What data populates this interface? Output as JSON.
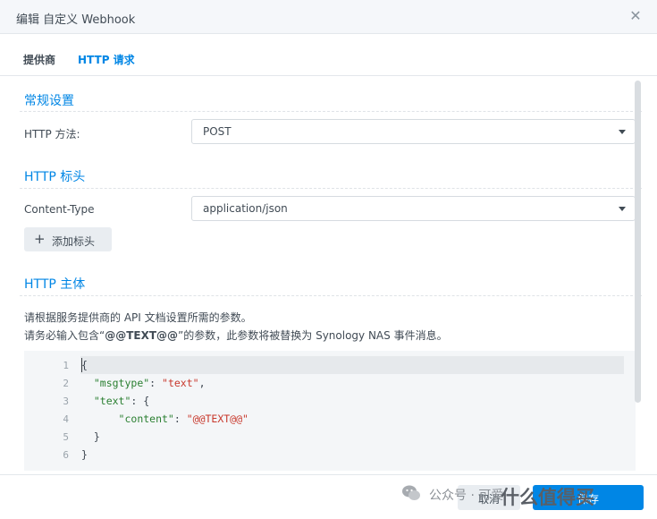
{
  "window": {
    "title": "编辑 自定义 Webhook",
    "close_icon": "close-icon"
  },
  "tabs": [
    {
      "label": "提供商"
    },
    {
      "label": "HTTP 请求"
    }
  ],
  "sections": {
    "general": {
      "title": "常规设置",
      "method_label": "HTTP 方法:",
      "method_value": "POST"
    },
    "headers": {
      "title": "HTTP 标头",
      "content_type_label": "Content-Type",
      "content_type_value": "application/json",
      "add_button_label": "添加标头"
    },
    "body": {
      "title": "HTTP 主体",
      "desc_line1": "请根据服务提供商的 API 文档设置所需的参数。",
      "desc_line2_prefix": "请务必输入包含“",
      "desc_line2_token": "@@TEXT@@",
      "desc_line2_suffix": "”的参数，此参数将被替换为 Synology NAS 事件消息。",
      "line_numbers": [
        "1",
        "2",
        "3",
        "4",
        "5",
        "6"
      ],
      "code": {
        "open": "{",
        "k1": "\"msgtype\"",
        "v1": "\"text\"",
        "k2": "\"text\"",
        "o2": ": {",
        "k3": "\"content\"",
        "v3": "\"@@TEXT@@\"",
        "close_inner": "}",
        "close_outer": "}"
      }
    }
  },
  "footer": {
    "cancel_label": "取消",
    "save_label": "保存"
  },
  "watermark": {
    "account": "公众号 · 可爱",
    "site": "什么值得买"
  },
  "colors": {
    "accent": "#0086e5",
    "json_key": "#2a7f31",
    "json_string": "#c8382c"
  }
}
